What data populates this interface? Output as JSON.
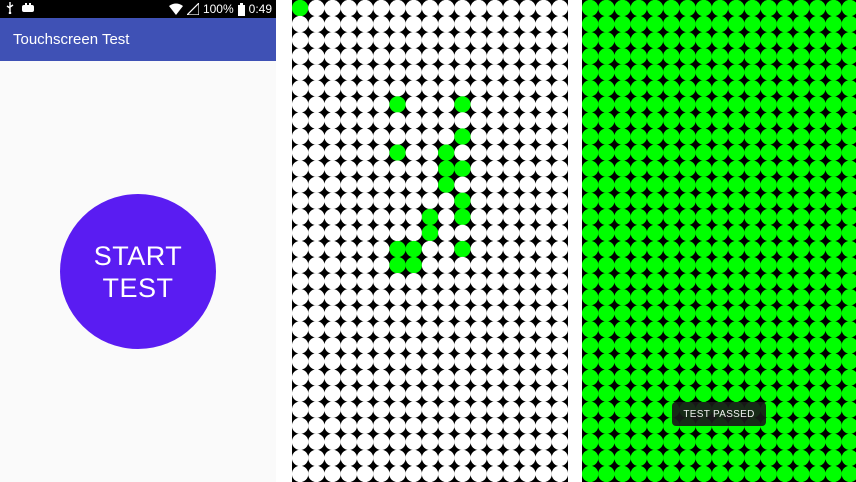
{
  "status_bar": {
    "battery_percent": "100%",
    "time": "0:49",
    "icons": [
      "usb-icon",
      "gamepad-icon",
      "wifi-icon",
      "signal-icon",
      "battery-icon"
    ]
  },
  "app": {
    "title": "Touchscreen Test",
    "start_button_line1": "START",
    "start_button_line2": "TEST",
    "toast_text": "TEST PASSED"
  },
  "colors": {
    "app_bar": "#3f51b5",
    "start_button": "#5a1cf2",
    "touched_dot": "#00ff00",
    "untouched_dot": "#ffffff",
    "grid_background": "#000000"
  },
  "touch_grid": {
    "columns": 17,
    "rows": 30,
    "panel_in_progress_touched_cells": [
      [
        0,
        0
      ],
      [
        6,
        6
      ],
      [
        10,
        6
      ],
      [
        10,
        8
      ],
      [
        6,
        9
      ],
      [
        9,
        9
      ],
      [
        9,
        10
      ],
      [
        10,
        10
      ],
      [
        9,
        11
      ],
      [
        10,
        12
      ],
      [
        8,
        13
      ],
      [
        10,
        13
      ],
      [
        8,
        14
      ],
      [
        6,
        15
      ],
      [
        7,
        15
      ],
      [
        10,
        15
      ],
      [
        6,
        16
      ],
      [
        7,
        16
      ]
    ],
    "panel_complete_all_touched": true
  }
}
